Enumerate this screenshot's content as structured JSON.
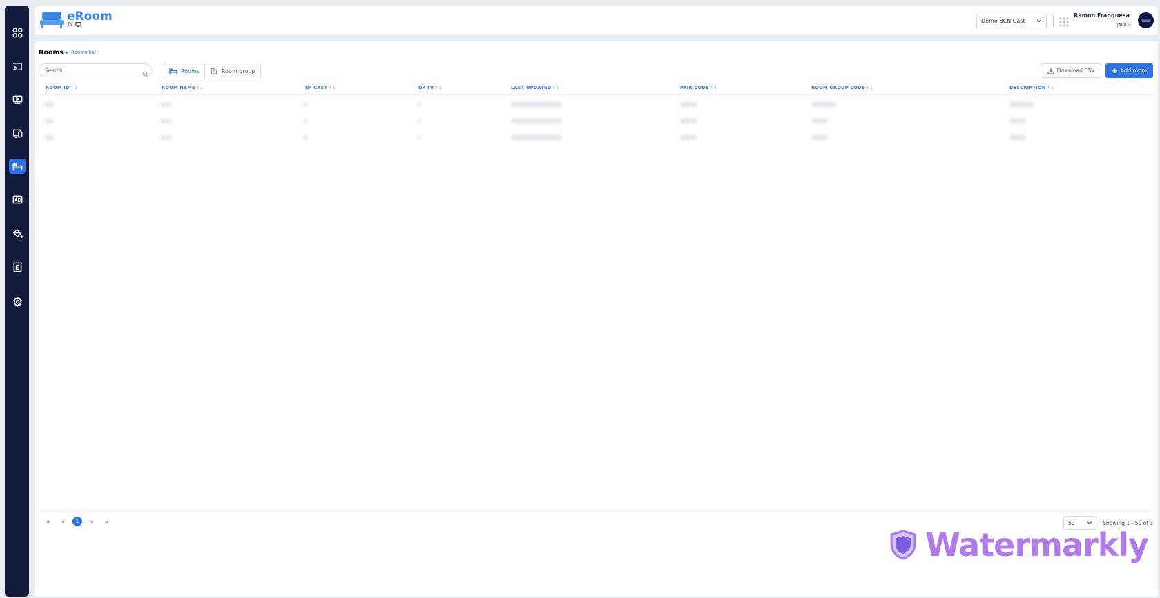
{
  "sidebar": {
    "items": [
      {
        "icon": "dashboard-icon",
        "active": false
      },
      {
        "icon": "cast-icon",
        "active": false
      },
      {
        "icon": "media-player-icon",
        "active": false
      },
      {
        "icon": "devices-icon",
        "active": false
      },
      {
        "icon": "bed-icon",
        "active": true
      },
      {
        "icon": "ad-icon",
        "active": false
      },
      {
        "icon": "paint-bucket-icon",
        "active": false
      },
      {
        "icon": "guide-book-icon",
        "active": false
      },
      {
        "icon": "settings-icon",
        "active": false
      }
    ]
  },
  "header": {
    "brand": "eRoom",
    "brand_sub": "TV",
    "site_select": "Demo BCN Cast",
    "user_name": "Ramon Franquesa",
    "user_org": "JACIDI"
  },
  "breadcrumb": {
    "title": "Rooms",
    "current": "Rooms list"
  },
  "toolbar": {
    "search_placeholder": "Search",
    "tab_rooms": "Rooms",
    "tab_room_group": "Room group",
    "download_csv": "Download CSV",
    "add_room": "Add room"
  },
  "table": {
    "columns": [
      "ROOM ID",
      "ROOM NAME",
      "Nº CAST",
      "Nº TV",
      "LAST UPDATED",
      "PAIR CODE",
      "ROOM GROUP CODE",
      "DESCRIPTION"
    ],
    "sort_glyph": "↑↓",
    "row_count": 3
  },
  "pagination": {
    "first": "«",
    "prev": "‹",
    "current_page": "1",
    "next": "›",
    "last": "»",
    "per_page": "50",
    "showing": "Showing 1 - 50 of 3"
  },
  "watermark": {
    "text": "Watermarkly"
  },
  "colors": {
    "sidebar_bg": "#141b3c",
    "accent": "#2f73e0",
    "page_bg": "#e9ecf1"
  }
}
